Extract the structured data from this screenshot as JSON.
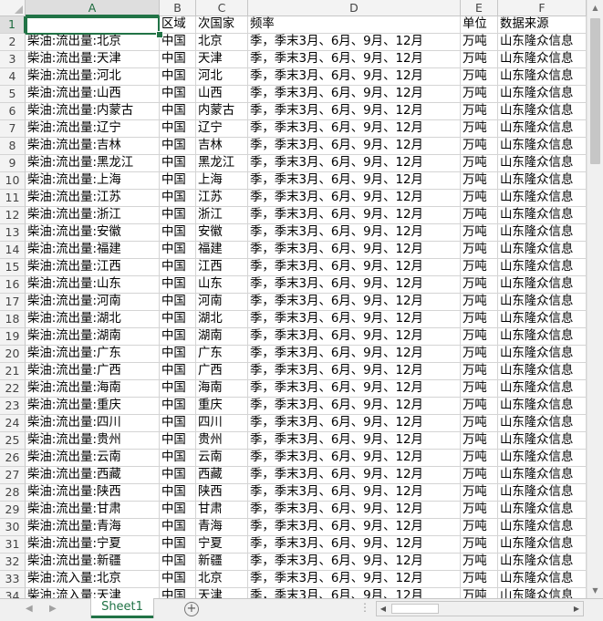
{
  "app": "Spreadsheet",
  "columns": [
    "A",
    "B",
    "C",
    "D",
    "E",
    "F"
  ],
  "active_cell": "A1",
  "header_row": [
    "",
    "区域",
    "次国家",
    "频率",
    "单位",
    "数据来源"
  ],
  "rows": [
    [
      "柴油:流出量:北京",
      "中国",
      "北京",
      "季，季末3月、6月、9月、12月",
      "万吨",
      "山东隆众信息"
    ],
    [
      "柴油:流出量:天津",
      "中国",
      "天津",
      "季，季末3月、6月、9月、12月",
      "万吨",
      "山东隆众信息"
    ],
    [
      "柴油:流出量:河北",
      "中国",
      "河北",
      "季，季末3月、6月、9月、12月",
      "万吨",
      "山东隆众信息"
    ],
    [
      "柴油:流出量:山西",
      "中国",
      "山西",
      "季，季末3月、6月、9月、12月",
      "万吨",
      "山东隆众信息"
    ],
    [
      "柴油:流出量:内蒙古",
      "中国",
      "内蒙古",
      "季，季末3月、6月、9月、12月",
      "万吨",
      "山东隆众信息"
    ],
    [
      "柴油:流出量:辽宁",
      "中国",
      "辽宁",
      "季，季末3月、6月、9月、12月",
      "万吨",
      "山东隆众信息"
    ],
    [
      "柴油:流出量:吉林",
      "中国",
      "吉林",
      "季，季末3月、6月、9月、12月",
      "万吨",
      "山东隆众信息"
    ],
    [
      "柴油:流出量:黑龙江",
      "中国",
      "黑龙江",
      "季，季末3月、6月、9月、12月",
      "万吨",
      "山东隆众信息"
    ],
    [
      "柴油:流出量:上海",
      "中国",
      "上海",
      "季，季末3月、6月、9月、12月",
      "万吨",
      "山东隆众信息"
    ],
    [
      "柴油:流出量:江苏",
      "中国",
      "江苏",
      "季，季末3月、6月、9月、12月",
      "万吨",
      "山东隆众信息"
    ],
    [
      "柴油:流出量:浙江",
      "中国",
      "浙江",
      "季，季末3月、6月、9月、12月",
      "万吨",
      "山东隆众信息"
    ],
    [
      "柴油:流出量:安徽",
      "中国",
      "安徽",
      "季，季末3月、6月、9月、12月",
      "万吨",
      "山东隆众信息"
    ],
    [
      "柴油:流出量:福建",
      "中国",
      "福建",
      "季，季末3月、6月、9月、12月",
      "万吨",
      "山东隆众信息"
    ],
    [
      "柴油:流出量:江西",
      "中国",
      "江西",
      "季，季末3月、6月、9月、12月",
      "万吨",
      "山东隆众信息"
    ],
    [
      "柴油:流出量:山东",
      "中国",
      "山东",
      "季，季末3月、6月、9月、12月",
      "万吨",
      "山东隆众信息"
    ],
    [
      "柴油:流出量:河南",
      "中国",
      "河南",
      "季，季末3月、6月、9月、12月",
      "万吨",
      "山东隆众信息"
    ],
    [
      "柴油:流出量:湖北",
      "中国",
      "湖北",
      "季，季末3月、6月、9月、12月",
      "万吨",
      "山东隆众信息"
    ],
    [
      "柴油:流出量:湖南",
      "中国",
      "湖南",
      "季，季末3月、6月、9月、12月",
      "万吨",
      "山东隆众信息"
    ],
    [
      "柴油:流出量:广东",
      "中国",
      "广东",
      "季，季末3月、6月、9月、12月",
      "万吨",
      "山东隆众信息"
    ],
    [
      "柴油:流出量:广西",
      "中国",
      "广西",
      "季，季末3月、6月、9月、12月",
      "万吨",
      "山东隆众信息"
    ],
    [
      "柴油:流出量:海南",
      "中国",
      "海南",
      "季，季末3月、6月、9月、12月",
      "万吨",
      "山东隆众信息"
    ],
    [
      "柴油:流出量:重庆",
      "中国",
      "重庆",
      "季，季末3月、6月、9月、12月",
      "万吨",
      "山东隆众信息"
    ],
    [
      "柴油:流出量:四川",
      "中国",
      "四川",
      "季，季末3月、6月、9月、12月",
      "万吨",
      "山东隆众信息"
    ],
    [
      "柴油:流出量:贵州",
      "中国",
      "贵州",
      "季，季末3月、6月、9月、12月",
      "万吨",
      "山东隆众信息"
    ],
    [
      "柴油:流出量:云南",
      "中国",
      "云南",
      "季，季末3月、6月、9月、12月",
      "万吨",
      "山东隆众信息"
    ],
    [
      "柴油:流出量:西藏",
      "中国",
      "西藏",
      "季，季末3月、6月、9月、12月",
      "万吨",
      "山东隆众信息"
    ],
    [
      "柴油:流出量:陕西",
      "中国",
      "陕西",
      "季，季末3月、6月、9月、12月",
      "万吨",
      "山东隆众信息"
    ],
    [
      "柴油:流出量:甘肃",
      "中国",
      "甘肃",
      "季，季末3月、6月、9月、12月",
      "万吨",
      "山东隆众信息"
    ],
    [
      "柴油:流出量:青海",
      "中国",
      "青海",
      "季，季末3月、6月、9月、12月",
      "万吨",
      "山东隆众信息"
    ],
    [
      "柴油:流出量:宁夏",
      "中国",
      "宁夏",
      "季，季末3月、6月、9月、12月",
      "万吨",
      "山东隆众信息"
    ],
    [
      "柴油:流出量:新疆",
      "中国",
      "新疆",
      "季，季末3月、6月、9月、12月",
      "万吨",
      "山东隆众信息"
    ],
    [
      "柴油:流入量:北京",
      "中国",
      "北京",
      "季，季末3月、6月、9月、12月",
      "万吨",
      "山东隆众信息"
    ],
    [
      "柴油:流入量:天津",
      "中国",
      "天津",
      "季，季末3月、6月、9月、12月",
      "万吨",
      "山东隆众信息"
    ]
  ],
  "sheet_tabs": [
    "Sheet1"
  ],
  "add_sheet_symbol": "+",
  "colors": {
    "accent": "#217346",
    "gridline": "#d4d4d4",
    "header_bg": "#f3f3f3"
  },
  "icons": {
    "scroll_up": "scroll-up-icon",
    "scroll_down": "scroll-down-icon",
    "tab_prev": "tab-prev-icon",
    "tab_next": "tab-next-icon",
    "add_sheet": "add-sheet-icon"
  }
}
